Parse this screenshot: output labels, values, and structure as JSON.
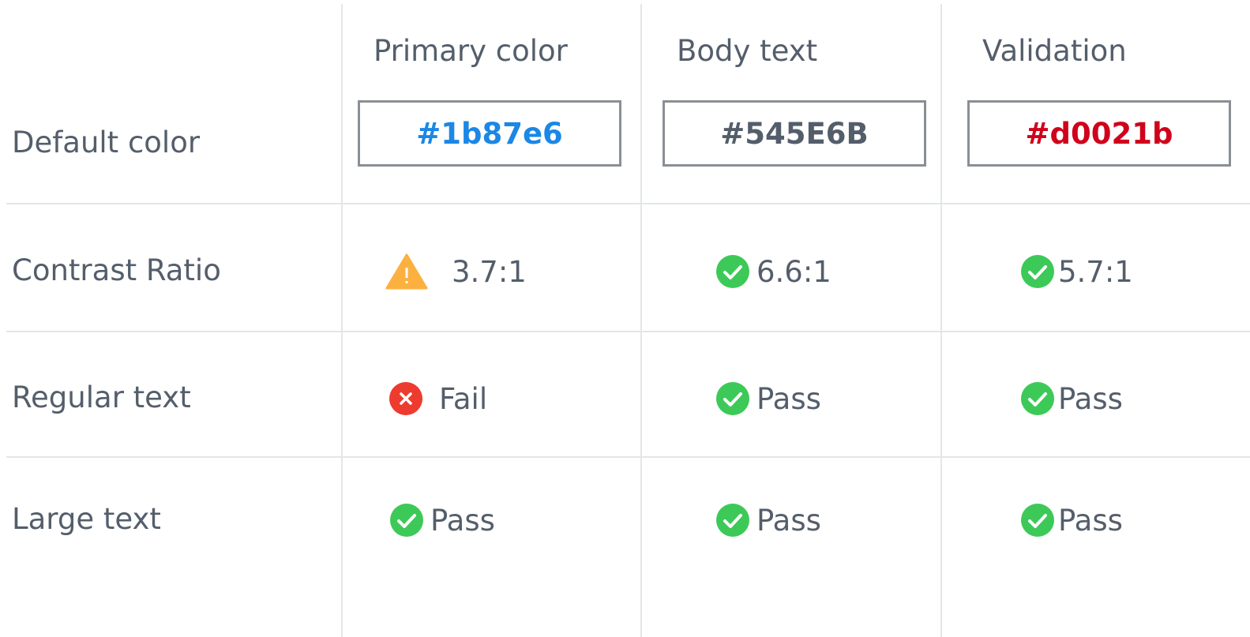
{
  "columns": [
    {
      "label": "Primary color",
      "hex": "#1b87e6",
      "hex_color": "#1b87e6"
    },
    {
      "label": "Body text",
      "hex": "#545E6B",
      "hex_color": "#545E6B"
    },
    {
      "label": "Validation",
      "hex": "#d0021b",
      "hex_color": "#d0021b"
    }
  ],
  "rows": {
    "default_color": {
      "label": "Default color"
    },
    "contrast_ratio": {
      "label": "Contrast Ratio",
      "cells": [
        {
          "value": "3.7:1",
          "status": "warning-icon"
        },
        {
          "value": "6.6:1",
          "status": "check-icon"
        },
        {
          "value": "5.7:1",
          "status": "check-icon"
        }
      ]
    },
    "regular_text": {
      "label": "Regular text",
      "cells": [
        {
          "value": "Fail",
          "status": "error-icon"
        },
        {
          "value": "Pass",
          "status": "check-icon"
        },
        {
          "value": "Pass",
          "status": "check-icon"
        }
      ]
    },
    "large_text": {
      "label": "Large text",
      "cells": [
        {
          "value": "Pass",
          "status": "check-icon"
        },
        {
          "value": "Pass",
          "status": "check-icon"
        },
        {
          "value": "Pass",
          "status": "check-icon"
        }
      ]
    }
  },
  "status_colors": {
    "pass": "#3dc958",
    "fail": "#ee3b2f",
    "warning": "#fbb040",
    "border": "#8a8f96",
    "grid": "#e3e5e8"
  }
}
